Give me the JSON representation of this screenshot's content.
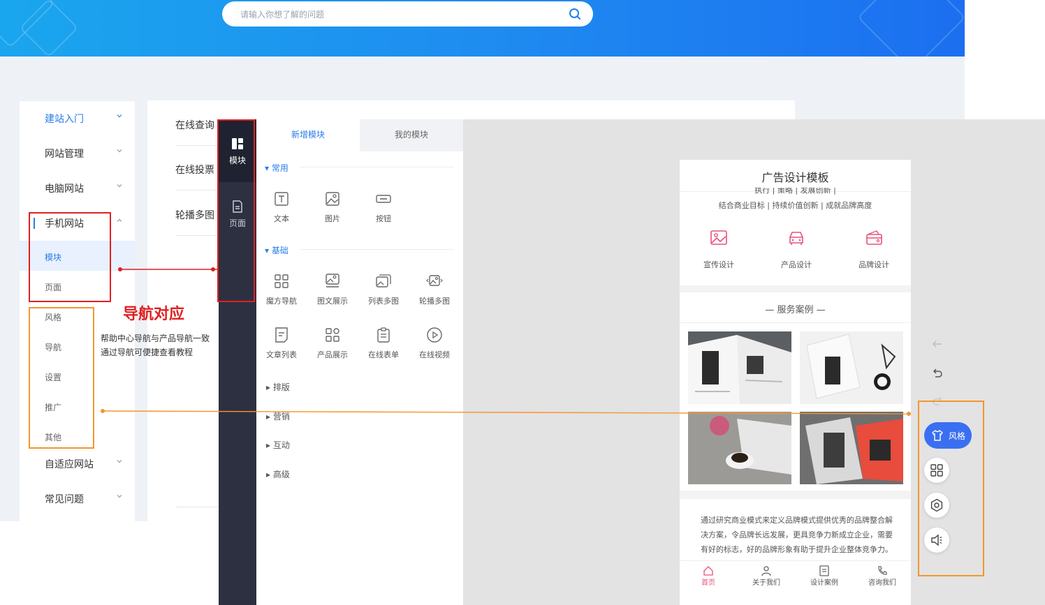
{
  "search": {
    "placeholder": "请输入你想了解的问题",
    "icon": "search-icon"
  },
  "sidebar": {
    "items": [
      {
        "label": "建站入门",
        "active": true
      },
      {
        "label": "网站管理"
      },
      {
        "label": "电脑网站"
      },
      {
        "label": "手机网站",
        "expanded": true
      },
      {
        "label": "自适应网站"
      },
      {
        "label": "常见问题"
      }
    ],
    "sub_items": [
      "模块",
      "页面",
      "风格",
      "导航",
      "设置",
      "推广",
      "其他"
    ]
  },
  "content": {
    "rows": [
      "在线查询",
      "在线投票",
      "轮播多图"
    ]
  },
  "editor": {
    "rail": [
      {
        "label": "模块",
        "icon": "module-icon"
      },
      {
        "label": "页面",
        "icon": "page-icon"
      }
    ],
    "tabs": [
      "新增模块",
      "我的模块"
    ],
    "sections": {
      "common": {
        "title": "常用",
        "items": [
          "文本",
          "图片",
          "按钮"
        ]
      },
      "basic": {
        "title": "基础",
        "items": [
          "魔方导航",
          "图文展示",
          "列表多图",
          "轮播多图",
          "文章列表",
          "产品展示",
          "在线表单",
          "在线视频"
        ]
      },
      "collapsed": [
        "排版",
        "营销",
        "互动",
        "高级"
      ]
    }
  },
  "phone": {
    "title": "广告设计模板",
    "sub1": "执行 | 策略 | 发展创新 |",
    "sub2": "结合商业目标 | 持续价值创新 | 成就品牌高度",
    "services": [
      "宣传设计",
      "产品设计",
      "品牌设计"
    ],
    "case_title": "— 服务案例 —",
    "description": "通过研究商业模式来定义品牌模式提供优秀的品牌整合解决方案，令品牌长远发展，更具竞争力新成立企业，需要有好的标志，好的品牌形象有助于提升企业整体竞争力。",
    "tabbar": [
      "首页",
      "关于我们",
      "设计案例",
      "咨询我们"
    ],
    "accent": "#e8527a"
  },
  "tools": {
    "style_label": "风格",
    "accent": "#3a6ff2"
  },
  "annotation": {
    "title": "导航对应",
    "line1": "帮助中心导航与产品导航一致",
    "line2": "通过导航可便捷查看教程",
    "red": "#e02020",
    "orange": "#f3962d"
  }
}
